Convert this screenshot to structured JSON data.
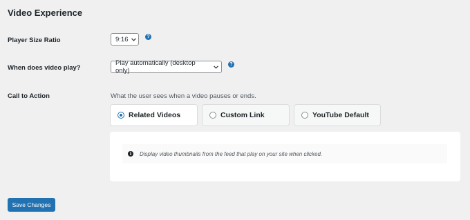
{
  "section": {
    "title": "Video Experience"
  },
  "player_size": {
    "label": "Player Size Ratio",
    "selected": "9:16",
    "help_icon": "question-icon"
  },
  "video_play": {
    "label": "When does video play?",
    "selected": "Play automatically (desktop only)",
    "help_icon": "question-icon"
  },
  "call_to_action": {
    "label": "Call to Action",
    "description": "What the user sees when a video pauses or ends.",
    "options": [
      {
        "label": "Related Videos",
        "selected": true
      },
      {
        "label": "Custom Link",
        "selected": false
      },
      {
        "label": "YouTube Default",
        "selected": false
      }
    ],
    "notice_icon": "info-icon",
    "notice": "Display video thumbnails from the feed that play on your site when clicked."
  },
  "save_button": {
    "label": "Save Changes"
  },
  "colors": {
    "accent": "#2271b1",
    "background": "#f0f0f1",
    "panel": "#ffffff"
  }
}
